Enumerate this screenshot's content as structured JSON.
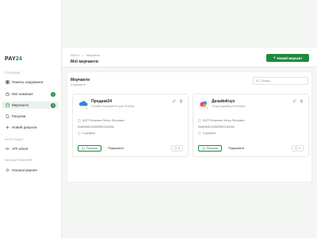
{
  "brand": {
    "name_prefix": "PAY",
    "name_suffix": "24"
  },
  "sidebar": {
    "sections": [
      {
        "title": "ГОЛОВНЕ"
      },
      {
        "title": "ІНТЕГРАЦІЇ"
      },
      {
        "title": "НАЛАШТУВАННЯ"
      }
    ],
    "items": [
      {
        "label": "Панель керування",
        "icon": "dashboard-icon"
      },
      {
        "label": "Мої компанії",
        "icon": "briefcase-icon",
        "badge": "1"
      },
      {
        "label": "Мерчанти",
        "icon": "store-icon",
        "badge": "2"
      },
      {
        "label": "Рахунки",
        "icon": "file-icon"
      },
      {
        "label": "Новий рахунок",
        "icon": "plus-icon"
      },
      {
        "label": "API ключі",
        "icon": "key-icon"
      },
      {
        "label": "Налаштування",
        "icon": "gear-icon"
      }
    ]
  },
  "header": {
    "breadcrumbs": [
      "PAY24",
      ">",
      "Мерчанти"
    ],
    "title": "Мої мерчанти",
    "new_button": "Новий мерчант"
  },
  "panel": {
    "title": "Мерчанти",
    "subtitle": "2 мерчанти",
    "search_placeholder": "Пошук..."
  },
  "merchants": [
    {
      "name": "Продажі24",
      "desc": "Онлайн-інструменти для бізнесу",
      "owner": "ФОП Петренко Петро Петрович",
      "id": "64a63b821d4f83f9b12a3c6b",
      "accounts": "0 рахунки",
      "accounts_btn": "Рахунки",
      "edit_btn": "Редагувати",
      "count": "0"
    },
    {
      "name": "ДизайнКоуз",
      "desc": "Студія дизайну інтер'єрів",
      "owner": "ФОП Петренко Петро Петрович",
      "id": "64a63b821d4f83f9b12a3c6b",
      "accounts": "3 рахунки",
      "accounts_btn": "Рахунки",
      "edit_btn": "Редагувати",
      "count": "1"
    }
  ],
  "colors": {
    "accent": "#1f8a3f",
    "status_online": "#27a14a"
  }
}
